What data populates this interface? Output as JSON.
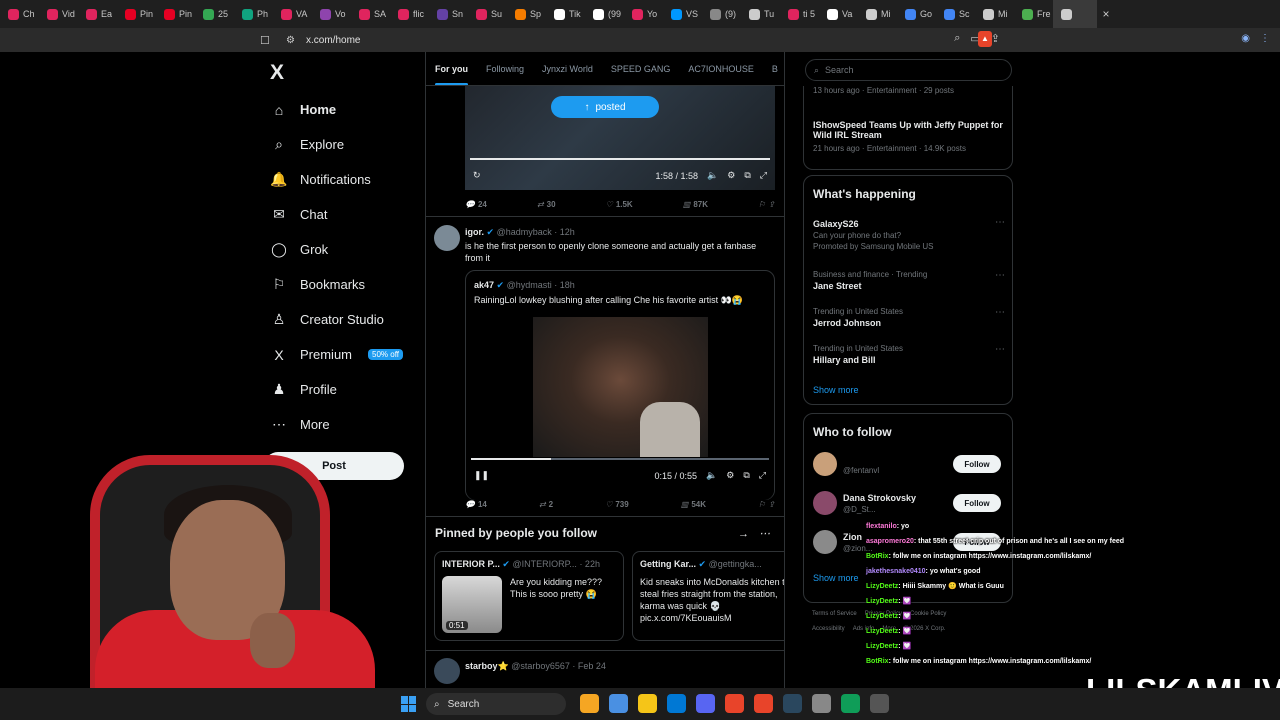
{
  "browser": {
    "tabs": [
      {
        "label": "Ch",
        "color": "#e0245e"
      },
      {
        "label": "Vid",
        "color": "#e0245e"
      },
      {
        "label": "Ea",
        "color": "#e0245e"
      },
      {
        "label": "Pin",
        "color": "#e60023"
      },
      {
        "label": "Pin",
        "color": "#e60023"
      },
      {
        "label": "25",
        "color": "#34a853"
      },
      {
        "label": "Ph",
        "color": "#10a37f"
      },
      {
        "label": "VA",
        "color": "#e0245e"
      },
      {
        "label": "Vo",
        "color": "#8e44ad"
      },
      {
        "label": "SA",
        "color": "#e0245e"
      },
      {
        "label": "flic",
        "color": "#e0245e"
      },
      {
        "label": "Sn",
        "color": "#6441a5"
      },
      {
        "label": "Su",
        "color": "#e0245e"
      },
      {
        "label": "Sp",
        "color": "#f57c00"
      },
      {
        "label": "Tik",
        "color": "#ffffff"
      },
      {
        "label": "(99",
        "color": "#ffffff"
      },
      {
        "label": "Yo",
        "color": "#e0245e"
      },
      {
        "label": "VS",
        "color": "#0098ff"
      },
      {
        "label": "(9)",
        "color": "#888888"
      },
      {
        "label": "Tu",
        "color": "#cccccc"
      },
      {
        "label": "ti 5",
        "color": "#e0245e"
      },
      {
        "label": "Va",
        "color": "#ffffff"
      },
      {
        "label": "Mi",
        "color": "#cccccc"
      },
      {
        "label": "Go",
        "color": "#4285f4"
      },
      {
        "label": "Sc",
        "color": "#4285f4"
      },
      {
        "label": "Mi",
        "color": "#cccccc"
      },
      {
        "label": "Fre",
        "color": "#4caf50"
      }
    ],
    "url": "x.com/home"
  },
  "x": {
    "logo": "X",
    "nav": [
      {
        "label": "Home",
        "icon": "home-icon",
        "glyph": "⌂",
        "name": "home"
      },
      {
        "label": "Explore",
        "icon": "search-icon",
        "glyph": "⌕",
        "name": "explore"
      },
      {
        "label": "Notifications",
        "icon": "bell-icon",
        "glyph": "🔔",
        "name": "notifications"
      },
      {
        "label": "Chat",
        "icon": "envelope-icon",
        "glyph": "✉",
        "name": "chat"
      },
      {
        "label": "Grok",
        "icon": "grok-icon",
        "glyph": "◯",
        "name": "grok"
      },
      {
        "label": "Bookmarks",
        "icon": "bookmark-icon",
        "glyph": "⚐",
        "name": "bookmarks"
      },
      {
        "label": "Creator Studio",
        "icon": "creator-icon",
        "glyph": "♙",
        "name": "creator-studio"
      },
      {
        "label": "Premium",
        "icon": "x-premium-icon",
        "glyph": "X",
        "name": "premium"
      },
      {
        "label": "Profile",
        "icon": "person-icon",
        "glyph": "♟",
        "name": "profile"
      },
      {
        "label": "More",
        "icon": "more-icon",
        "glyph": "⋯",
        "name": "more"
      }
    ],
    "premium_badge": "50% off",
    "post_button": "Post",
    "feed_tabs": [
      "For you",
      "Following",
      "Jynxzi World",
      "SPEED GANG",
      "AC7IONHOUSE",
      "B"
    ],
    "video1": {
      "posted": "posted",
      "time": "1:58 / 1:58",
      "progress": 1.0,
      "stats": {
        "replies": "24",
        "reposts": "30",
        "likes": "1.5K",
        "views": "87K"
      }
    },
    "tweet": {
      "name": "igor.",
      "handle": "@hadmyback",
      "time": "· 12h",
      "text": "is he the first person to openly clone someone and actually get a fanbase from it",
      "quote": {
        "name": "ak47",
        "handle": "@hydmasti",
        "time": "· 18h",
        "text": "RainingLol lowkey blushing after calling Che his favorite artist 👀😭"
      },
      "video_time": "0:15 / 0:55",
      "progress": 0.27,
      "stats": {
        "replies": "14",
        "reposts": "2",
        "likes": "739",
        "views": "54K"
      }
    },
    "pinned": {
      "title": "Pinned by people you follow",
      "cards": [
        {
          "name": "INTERIOR P...",
          "handle": "@INTERIORP...",
          "time": "· 22h",
          "text": "Are you kidding me??? This is sooo pretty 😭",
          "duration": "0:51"
        },
        {
          "name": "Getting Kar...",
          "handle": "@gettingka...",
          "time": "",
          "text": "Kid sneaks into McDonalds kitchen to steal fries straight from the station, karma was quick 💀 pic.x.com/7KEouauisM"
        }
      ]
    },
    "last_post": {
      "name": "starboy⭐",
      "handle": "@starboy6567",
      "time": "· Feb 24"
    },
    "search_placeholder": "Search",
    "top_trends": [
      {
        "meta": "13 hours ago · Entertainment · 29 posts"
      },
      {
        "title": "IShowSpeed Teams Up with Jeffy Puppet for Wild IRL Stream",
        "meta": "21 hours ago · Entertainment · 14.9K posts"
      }
    ],
    "happening": {
      "title": "What's happening",
      "items": [
        {
          "meta": "",
          "name": "GalaxyS26",
          "sub": "Can your phone do that?"
        },
        {
          "meta": "",
          "name": "",
          "sub": "Promoted by Samsung Mobile US"
        },
        {
          "meta": "Business and finance · Trending",
          "name": "Jane Street",
          "sub": ""
        },
        {
          "meta": "Trending in United States",
          "name": "Jerrod Johnson",
          "sub": ""
        },
        {
          "meta": "Trending in United States",
          "name": "Hillary and Bill",
          "sub": ""
        }
      ],
      "show_more": "Show more"
    },
    "who_to_follow": {
      "title": "Who to follow",
      "users": [
        {
          "name": "",
          "handle": "@fentanvl",
          "follow": "Follow"
        },
        {
          "name": "Dana Strokovsky",
          "handle": "@D_St...",
          "follow": "Follow"
        },
        {
          "name": "Zion",
          "handle": "@zion...",
          "follow": "Follow"
        }
      ],
      "show_more": "Show more"
    },
    "footer": [
      "Terms of Service",
      "Privacy Policy",
      "Cookie Policy",
      "Accessibility",
      "Ads info",
      "More",
      "© 2026 X Corp."
    ]
  },
  "stream": {
    "chat": [
      {
        "user": "flextanilo",
        "color": "#ff7ad9",
        "msg": ": yo"
      },
      {
        "user": "asapromero20",
        "color": "#ff7ad9",
        "msg": ": that 55th street crip out of prison and he's all I see on my feed"
      },
      {
        "user": "BotRix",
        "color": "#53fc18",
        "msg": ": follw me on instagram https://www.instagram.com/lilskamx/"
      },
      {
        "user": "jakethesnake0410",
        "color": "#b38bff",
        "msg": ": yo what's good"
      },
      {
        "user": "LizyDeetz",
        "color": "#53fc18",
        "msg": ": Hiiii Skammy 🙂  What is Guuu"
      },
      {
        "user": "LizyDeetz",
        "color": "#53fc18",
        "msg": ": 💟"
      },
      {
        "user": "LizyDeetz",
        "color": "#53fc18",
        "msg": ": 💟"
      },
      {
        "user": "LizyDeetz",
        "color": "#53fc18",
        "msg": ": 💟"
      },
      {
        "user": "LizyDeetz",
        "color": "#53fc18",
        "msg": ": 💟"
      },
      {
        "user": "BotRix",
        "color": "#53fc18",
        "msg": ": follw me on instagram https://www.instagram.com/lilskamx/"
      }
    ],
    "watermark": "LILSKAMLIVE"
  },
  "taskbar": {
    "search": "Search",
    "icons": [
      "#f5a623",
      "#4a90e2",
      "#f5c518",
      "#0078d4",
      "#5865f2",
      "#e8442a",
      "#e8442a",
      "#2a475e",
      "#888888",
      "#0f9d58",
      "#555555"
    ]
  },
  "colors": {
    "accent": "#1d9bf0",
    "background": "#000000",
    "border": "#2f3336",
    "streamer_red": "#d4202a"
  }
}
